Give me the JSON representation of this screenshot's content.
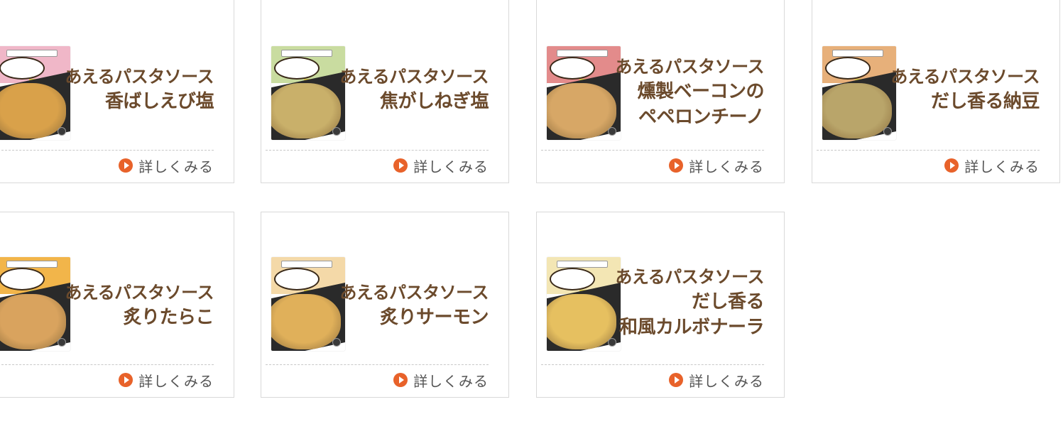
{
  "products": [
    {
      "name_line1": "あえるパスタソース",
      "name_lines": [
        "香ばしえび塩"
      ],
      "package_label": "香ばしえび塩",
      "package_color": "#f0b7c8",
      "pasta_color": "#d9a14a",
      "more_label": "詳しくみる"
    },
    {
      "name_line1": "あえるパスタソース",
      "name_lines": [
        "焦がしねぎ塩"
      ],
      "package_label": "焦がしねぎ塩",
      "package_color": "#c9dca0",
      "pasta_color": "#c9b06a",
      "more_label": "詳しくみる"
    },
    {
      "name_line1": "あえるパスタソース",
      "name_lines": [
        "燻製ベーコンの",
        "ペペロンチーノ"
      ],
      "package_label": "燻製ベーコンのペペロンチーノ",
      "package_color": "#e38b8b",
      "pasta_color": "#d7a766",
      "more_label": "詳しくみる"
    },
    {
      "name_line1": "あえるパスタソース",
      "name_lines": [
        "だし香る納豆"
      ],
      "package_label": "だし香る納豆",
      "package_color": "#e7b07a",
      "pasta_color": "#b9a56a",
      "more_label": "詳しくみる"
    },
    {
      "name_line1": "あえるパスタソース",
      "name_lines": [
        "炙りたらこ"
      ],
      "package_label": "炙りたらこ",
      "package_color": "#f2b54a",
      "pasta_color": "#d9a35e",
      "more_label": "詳しくみる"
    },
    {
      "name_line1": "あえるパスタソース",
      "name_lines": [
        "炙りサーモン"
      ],
      "package_label": "炙りサーモン",
      "package_color": "#f4d9a8",
      "pasta_color": "#e0b05a",
      "more_label": "詳しくみる"
    },
    {
      "name_line1": "あえるパスタソース",
      "name_lines": [
        "だし香る",
        "和風カルボナーラ"
      ],
      "package_label": "だし香る和風カルボナーラ",
      "package_color": "#f3e6b4",
      "pasta_color": "#e6c060",
      "more_label": "詳しくみる"
    }
  ],
  "colors": {
    "title_brown": "#6b4a2c",
    "more_icon": "#e8622a",
    "more_text": "#555555",
    "card_border": "#d9d9d9"
  },
  "icons": {
    "more": "play-circle-icon"
  }
}
